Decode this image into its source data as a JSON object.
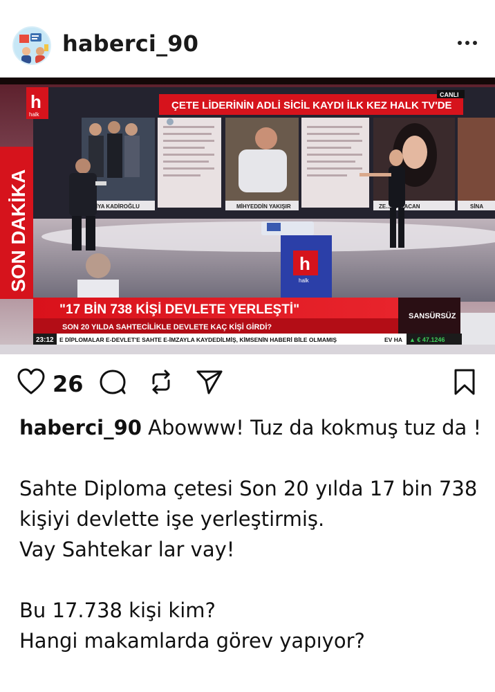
{
  "post": {
    "username": "haberci_90",
    "likes": "26",
    "caption_user": "haberci_90",
    "caption_first": "Abowww! Tuz da kokmuş tuz da !",
    "caption_lines": [
      "Sahte Diploma çetesi Son 20 yılda 17 bin 738 kişiyi devlette işe yerleştirmiş.",
      "Vay Sahtekar lar vay!"
    ],
    "caption_lines2": [
      "Bu 17.738 kişi kim?",
      "Hangi makamlarda görev yapıyor?"
    ]
  },
  "media": {
    "channel_logo": "h",
    "channel_sub": "halk",
    "live": "CANLI",
    "banner": "ÇETE LİDERİNİN ADLİ SİCİL KAYDI İLK KEZ HALK TV'DE",
    "side_label": "SON DAKİKA",
    "name1": "ZİYA KADİROĞLU",
    "name2": "MİHYEDDİN YAKIŞIR",
    "name3": "ZE... KARACAN",
    "name4": "SİNA",
    "headline": "\"17 BİN 738 KİŞİ DEVLETE YERLEŞTİ\"",
    "subheadline": "SON 20 YILDA SAHTECİLİKLE DEVLETE KAÇ KİŞİ GİRDİ?",
    "program": "SANSÜRSÜZ",
    "clock": "23:12",
    "ticker": "E DİPLOMALAR E-DEVLET'E SAHTE E-İMZAYLA KAYDEDİLMİŞ, KİMSENİN HABERİ BİLE OLMAMIŞ",
    "ticker2": "EV HA",
    "currency": "▲ € 47.1246"
  },
  "icons": {
    "like": "heart-icon",
    "comment": "comment-icon",
    "repost": "repost-icon",
    "share": "send-icon",
    "save": "bookmark-icon",
    "more": "more-icon"
  }
}
